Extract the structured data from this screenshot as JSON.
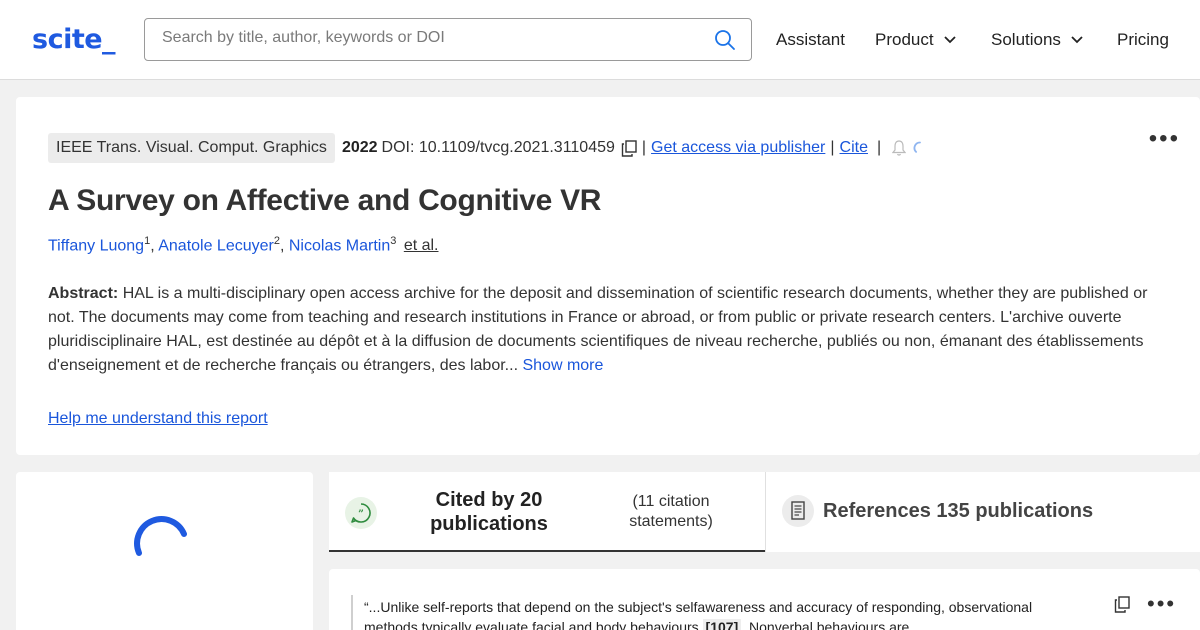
{
  "header": {
    "logo": "scite_",
    "search_placeholder": "Search by title, author, keywords or DOI",
    "nav": {
      "assistant": "Assistant",
      "product": "Product",
      "solutions": "Solutions",
      "pricing": "Pricing"
    }
  },
  "paper": {
    "journal": "IEEE Trans. Visual. Comput. Graphics",
    "year": "2022",
    "doi": "DOI: 10.1109/tvcg.2021.3110459",
    "access_link": "Get access via publisher",
    "cite_link": "Cite",
    "title": "A Survey on Affective and Cognitive VR",
    "authors": [
      {
        "name": "Tiffany Luong",
        "sup": "1"
      },
      {
        "name": "Anatole Lecuyer",
        "sup": "2"
      },
      {
        "name": "Nicolas Martin",
        "sup": "3"
      }
    ],
    "et_al": "et al.",
    "abstract_label": "Abstract:",
    "abstract_text": "HAL is a multi-disciplinary open access archive for the deposit and dissemination of scientific research documents, whether they are published or not. The documents may come from teaching and research institutions in France or abroad, or from public or private research centers. L'archive ouverte pluridisciplinaire HAL, est destinée au dépôt et à la diffusion de documents scientifiques de niveau recherche, publiés ou non, émanant des établissements d'enseignement et de recherche français ou étrangers, des labor...",
    "show_more": "Show more",
    "help_link": "Help me understand this report"
  },
  "tabs": {
    "cited_label": "Cited by 20 publications",
    "cited_sub": "(11 citation statements)",
    "refs_label": "References 135 publications"
  },
  "citation": {
    "snippet_a": "“...Unlike self-reports that depend on the subject's selfawareness and accuracy of responding, observational methods typically evaluate facial and body behaviours",
    "ref": "[107]",
    "snippet_b": ". Nonverbal behaviours are"
  },
  "colors": {
    "brand": "#1f5ae0",
    "link": "#1a56db",
    "background": "#f1f1f1"
  },
  "icons": [
    "search-icon",
    "chevron-down-icon",
    "copy-icon",
    "bell-icon",
    "loading-spinner-icon",
    "chat-bubble-icon",
    "document-icon",
    "more-dots-icon"
  ]
}
